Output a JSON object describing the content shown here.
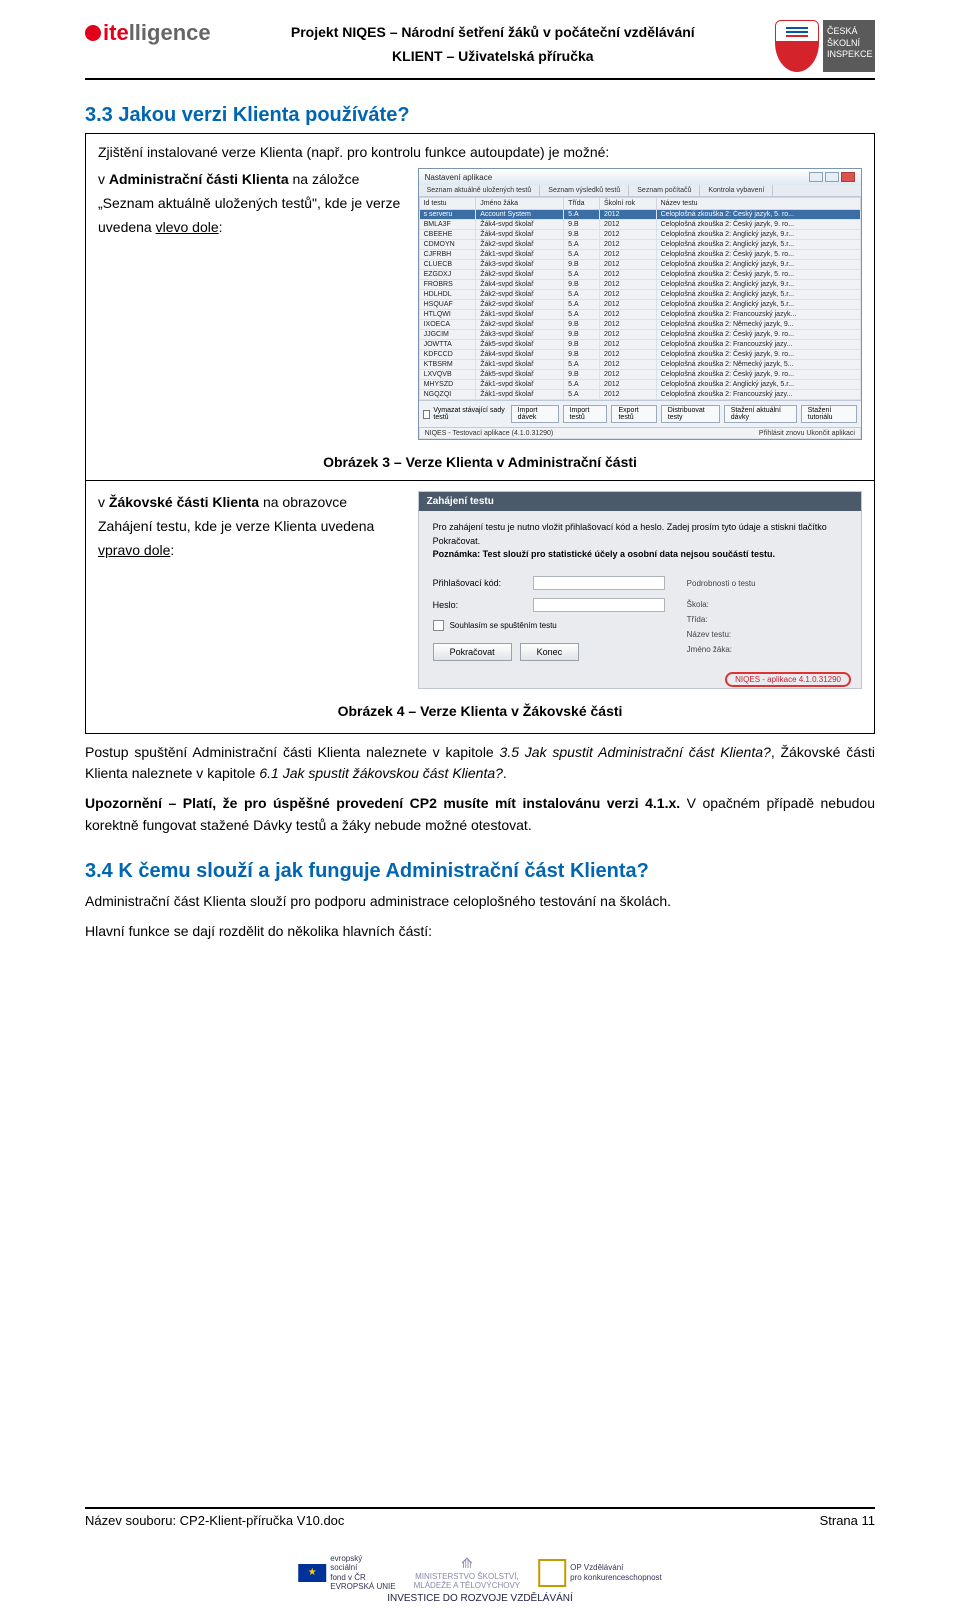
{
  "header": {
    "project_line": "Projekt NIQES – Národní šetření žáků v počáteční vzdělávání",
    "subtitle": "KLIENT – Uživatelská příručka",
    "csi_label": "ČESKÁ ŠKOLNÍ INSPEKCE"
  },
  "section33": {
    "num_title": "3.3  Jakou verzi Klienta používáte?",
    "intro": "Zjištění instalované verze Klienta (např. pro kontrolu funkce autoupdate) je možné:",
    "left1_prefix": "v ",
    "left1_bold": "Administrační části Klienta",
    "left1_rest1": " na záložce „Seznam aktuálně uložených testů\", kde je verze uvedena ",
    "left1_under": "vlevo dole",
    "caption1": "Obrázek 3 – Verze Klienta v Administrační části",
    "left2_prefix": "v ",
    "left2_bold": "Žákovské části Klienta",
    "left2_rest1": " na obrazovce Zahájení testu, kde je verze Klienta uvedena ",
    "left2_under": "vpravo dole",
    "caption2": "Obrázek 4 – Verze Klienta v Žákovské části"
  },
  "app1": {
    "title": "Nastavení aplikace",
    "tabs": [
      "Seznam aktuálně uložených testů",
      "Seznam výsledků testů",
      "Seznam počítačů",
      "Kontrola vybavení"
    ],
    "cols": [
      "Id testu",
      "Jméno žáka",
      "Třída",
      "Školní rok",
      "Název testu"
    ],
    "rows": [
      [
        "s serveru",
        "Account System",
        "5.A",
        "2012",
        "Celoplošná zkouška 2: Český jazyk, 5. ro..."
      ],
      [
        "BMLA3F",
        "Žák4-svpd školař",
        "9.B",
        "2012",
        "Celoplošná zkouška 2: Český jazyk, 9. ro..."
      ],
      [
        "CBEEHE",
        "Žák4-svpd školař",
        "9.B",
        "2012",
        "Celoplošná zkouška 2: Anglický jazyk, 9.r..."
      ],
      [
        "CDMOYN",
        "Žák2-svpd školař",
        "5.A",
        "2012",
        "Celoplošná zkouška 2: Anglický jazyk, 5.r..."
      ],
      [
        "CJFRBH",
        "Žák1-svpd školař",
        "5.A",
        "2012",
        "Celoplošná zkouška 2: Český jazyk, 5. ro..."
      ],
      [
        "CLUECB",
        "Žák3-svpd školař",
        "9.B",
        "2012",
        "Celoplošná zkouška 2: Anglický jazyk, 9.r..."
      ],
      [
        "EZGDXJ",
        "Žák2-svpd školař",
        "5.A",
        "2012",
        "Celoplošná zkouška 2: Český jazyk, 5. ro..."
      ],
      [
        "FROBRS",
        "Žák4-svpd školař",
        "9.B",
        "2012",
        "Celoplošná zkouška 2: Anglický jazyk, 9.r..."
      ],
      [
        "HDLHDL",
        "Žák2-svpd školař",
        "5.A",
        "2012",
        "Celoplošná zkouška 2: Anglický jazyk, 5.r..."
      ],
      [
        "HSQUAF",
        "Žák2-svpd školař",
        "5.A",
        "2012",
        "Celoplošná zkouška 2: Anglický jazyk, 5.r..."
      ],
      [
        "HTLQWI",
        "Žák1-svpd školař",
        "5.A",
        "2012",
        "Celoplošná zkouška 2: Francouzský jazyk..."
      ],
      [
        "IXOECA",
        "Žák2-svpd školař",
        "9.B",
        "2012",
        "Celoplošná zkouška 2: Německý jazyk, 9..."
      ],
      [
        "JJGCIM",
        "Žák3-svpd školař",
        "9.B",
        "2012",
        "Celoplošná zkouška 2: Český jazyk, 9. ro..."
      ],
      [
        "JOWTTA",
        "Žák5-svpd školař",
        "9.B",
        "2012",
        "Celoplošná zkouška 2: Francouzský jazy..."
      ],
      [
        "KDFCCD",
        "Žák4-svpd školař",
        "9.B",
        "2012",
        "Celoplošná zkouška 2: Český jazyk, 9. ro..."
      ],
      [
        "KTBSRM",
        "Žák1-svpd školař",
        "5.A",
        "2012",
        "Celoplošná zkouška 2: Německý jazyk, 5..."
      ],
      [
        "LXVQVB",
        "Žák5-svpd školař",
        "9.B",
        "2012",
        "Celoplošná zkouška 2: Český jazyk, 9. ro..."
      ],
      [
        "MHYSZD",
        "Žák1-svpd školař",
        "5.A",
        "2012",
        "Celoplošná zkouška 2: Anglický jazyk, 5.r..."
      ],
      [
        "NGQZQI",
        "Žák1-svpd školař",
        "5.A",
        "2012",
        "Celoplošná zkouška 2: Francouzský jazy..."
      ]
    ],
    "toolbar_check": "Vymazat stávající sady testů",
    "buttons": [
      "Import dávek",
      "Import testů",
      "Export testů",
      "Distribuovat testy",
      "Stažení aktuální dávky",
      "Stažení tutoriálu"
    ],
    "status_left": "NIQES - Testovací aplikace (4.1.0.31290)",
    "status_btns": [
      "Přihlásit znovu",
      "Ukončit aplikaci"
    ]
  },
  "app2": {
    "header": "Zahájení testu",
    "note_line1": "Pro zahájení testu je nutno vložit přihlašovací kód a heslo. Zadej prosím tyto údaje a stiskni tlačítko Pokračovat.",
    "note_line2": "Poznámka: Test slouží pro statistické účely a osobní data nejsou součástí testu.",
    "field1": "Přihlašovací kód:",
    "field2": "Heslo:",
    "check": "Souhlasím se spuštěním testu",
    "btn1": "Pokračovat",
    "btn2": "Konec",
    "right_hdr": "Podrobnosti o testu",
    "right1": "Škola:",
    "right2": "Třída:",
    "right3": "Název testu:",
    "right4": "Jméno žáka:",
    "version": "NIQES - aplikace 4.1.0.31290"
  },
  "bodytext": {
    "p1_a": "Postup spuštění Administrační části Klienta naleznete v kapitole ",
    "p1_i1": "3.5 Jak spustit Administrační část Klienta?",
    "p1_b": ", Žákovské části Klienta naleznete v kapitole ",
    "p1_i2": "6.1 Jak spustit žákovskou část Klienta?",
    "p1_c": ".",
    "p2_b": "Upozornění – Platí, že pro úspěšné provedení CP2 musíte mít instalovánu verzi 4.1.x.",
    "p2_r": " V opačném případě nebudou korektně fungovat stažené Dávky testů a žáky nebude možné otestovat."
  },
  "section34": {
    "num_title": "3.4  K čemu slouží a jak funguje Administrační část Klienta?",
    "p1": "Administrační část Klienta slouží pro podporu administrace celoplošného testování na školách.",
    "p2": "Hlavní funkce se dají rozdělit do několika hlavních částí:"
  },
  "footer": {
    "left": "Název souboru: CP2-Klient-příručka V10.doc",
    "right": "Strana 11",
    "sponsor1a": "evropský",
    "sponsor1b": "sociální",
    "sponsor1c": "fond v ČR",
    "sponsor1d": "EVROPSKÁ UNIE",
    "sponsor2a": "MINISTERSTVO ŠKOLSTVÍ,",
    "sponsor2b": "MLÁDEŽE A TĚLOVÝCHOVY",
    "sponsor3a": "OP Vzdělávání",
    "sponsor3b": "pro konkurenceschopnost",
    "band": "INVESTICE DO ROZVOJE VZDĚLÁVÁNÍ"
  }
}
